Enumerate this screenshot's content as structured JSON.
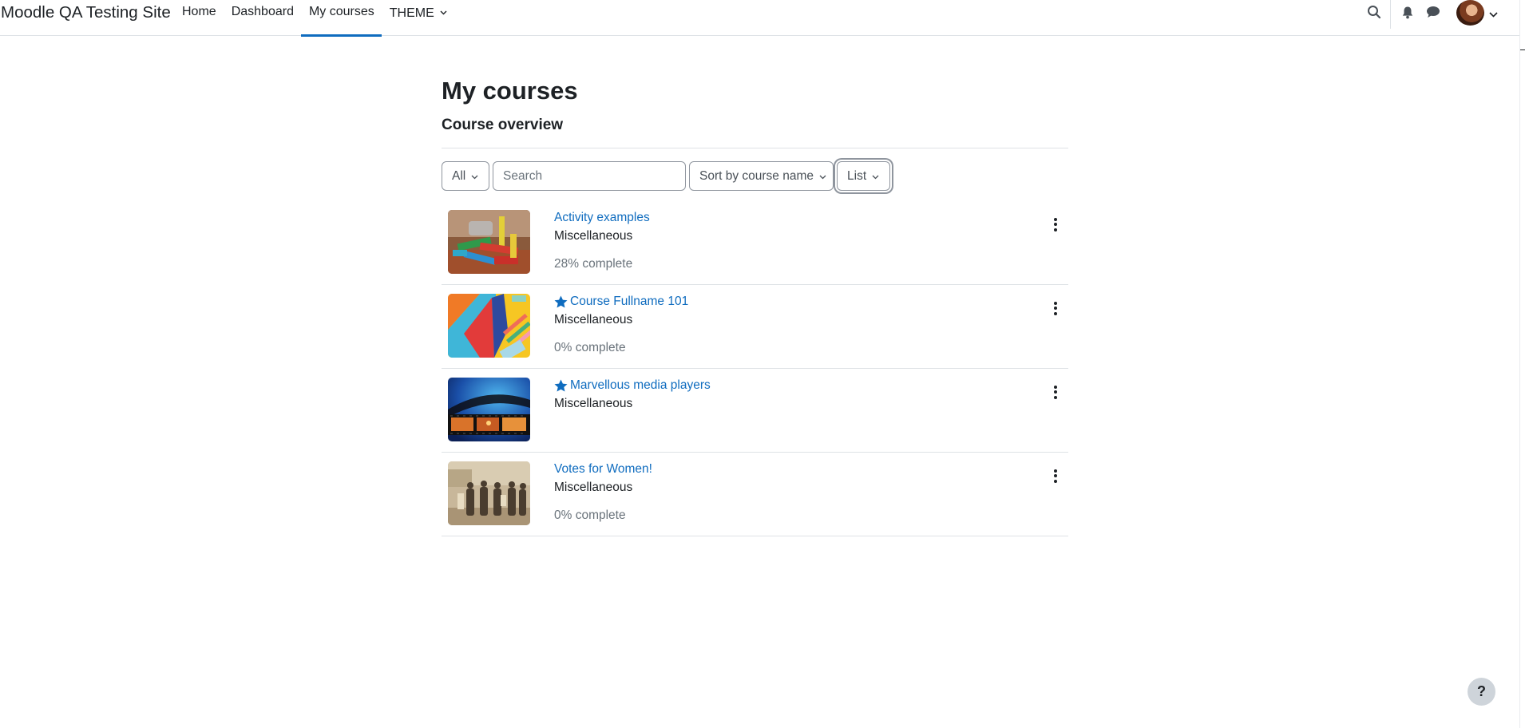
{
  "site": {
    "name": "Moodle QA Testing Site"
  },
  "nav": {
    "items": [
      {
        "label": "Home",
        "active": false
      },
      {
        "label": "Dashboard",
        "active": false
      },
      {
        "label": "My courses",
        "active": true
      },
      {
        "label": "THEME",
        "active": false,
        "dropdown": true
      }
    ],
    "icons": [
      "search-icon",
      "bell-icon",
      "chat-icon",
      "avatar",
      "chevron-down-icon"
    ]
  },
  "page": {
    "title": "My courses",
    "section_title": "Course overview"
  },
  "filters": {
    "grouping": "All",
    "search_placeholder": "Search",
    "sort": "Sort by course name",
    "view": "List"
  },
  "courses": [
    {
      "name": "Activity examples",
      "category": "Miscellaneous",
      "progress": "28% complete",
      "starred": false,
      "image": "colorful-wooden-blocks"
    },
    {
      "name": "Course Fullname 101",
      "category": "Miscellaneous",
      "progress": "0% complete",
      "starred": true,
      "image": "colored-paper-and-pencils"
    },
    {
      "name": "Marvellous media players",
      "category": "Miscellaneous",
      "progress": "",
      "starred": true,
      "image": "film-strip"
    },
    {
      "name": "Votes for Women!",
      "category": "Miscellaneous",
      "progress": "0% complete",
      "starred": false,
      "image": "sepia-suffragettes-photo"
    }
  ],
  "help": {
    "label": "?"
  },
  "colors": {
    "accent": "#0f6cbf",
    "text": "#1d2125",
    "muted": "#6a737b",
    "border": "#dee2e6"
  }
}
